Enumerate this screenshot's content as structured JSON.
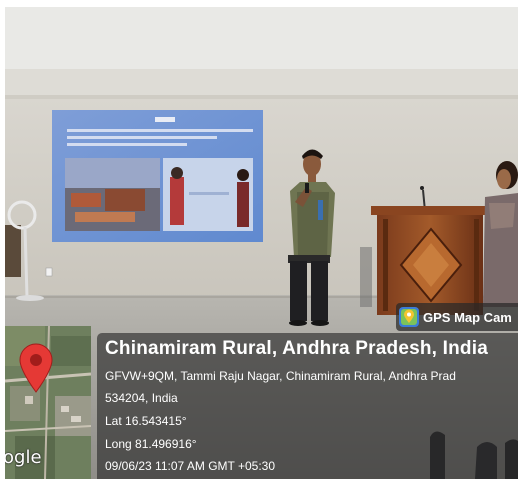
{
  "gps_tag": {
    "label": "GPS Map Cam"
  },
  "location": {
    "title": "Chinamiram Rural, Andhra Pradesh, India",
    "address_line_1": "GFVW+9QM, Tammi Raju Nagar, Chinamiram Rural, Andhra Prad",
    "address_line_2": "534204, India",
    "latitude": "Lat 16.543415°",
    "longitude": "Long 81.496916°",
    "timestamp": "09/06/23 11:07 AM GMT +05:30"
  },
  "map": {
    "attribution": "ogle"
  },
  "colors": {
    "pin": "#e53935",
    "overlay": "#2d2d2d"
  },
  "icons": {
    "camera": "gps-map-camera-icon",
    "pin": "map-pin-icon"
  }
}
